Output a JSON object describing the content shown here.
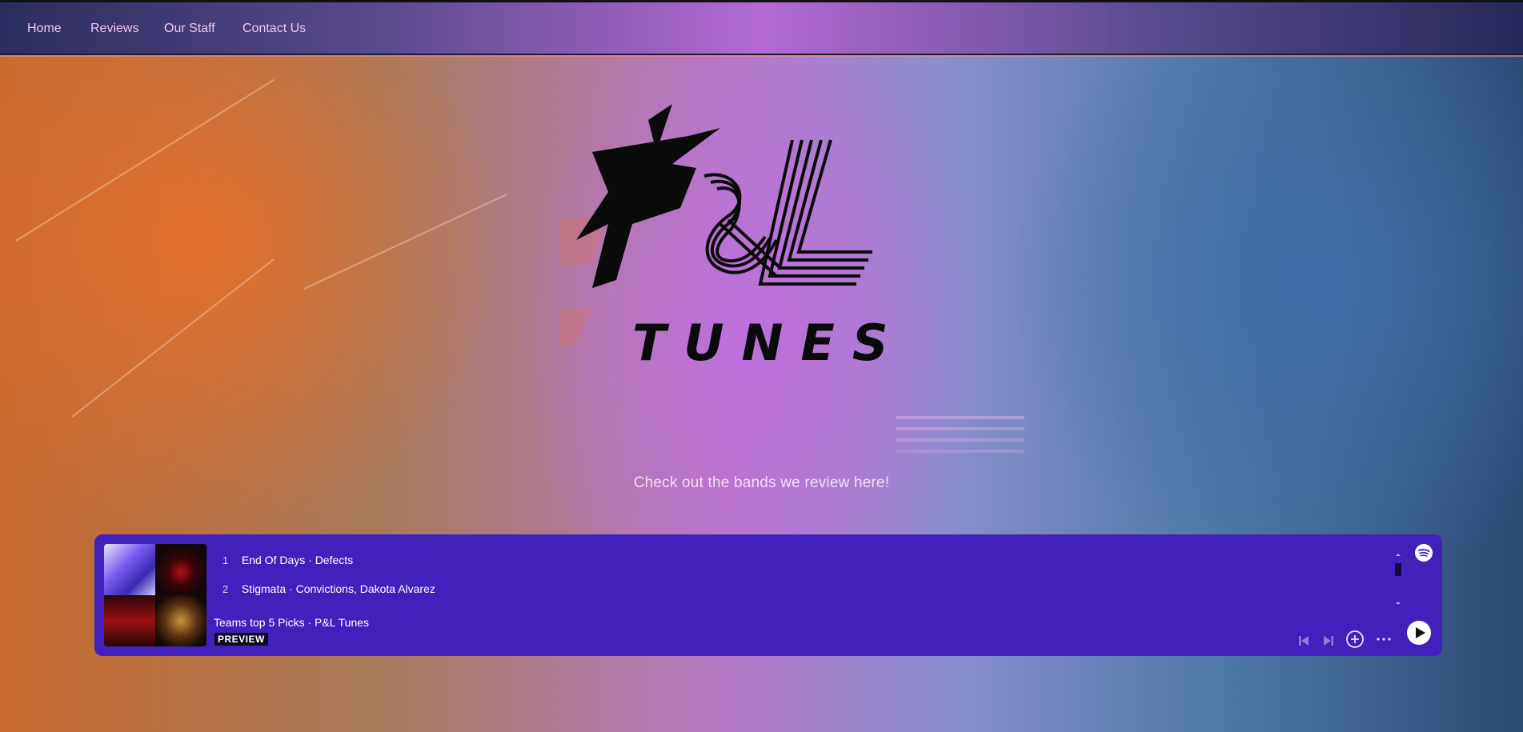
{
  "nav": {
    "items": [
      {
        "label": "Home"
      },
      {
        "label": "Reviews"
      },
      {
        "label": "Our Staff"
      },
      {
        "label": "Contact Us"
      }
    ]
  },
  "hero": {
    "logo_text": "P&L TUNES",
    "tagline": "Check out the bands we review here!"
  },
  "player": {
    "tracks": [
      {
        "number": "1",
        "title": "End Of Days · Defects"
      },
      {
        "number": "2",
        "title": "Stigmata · Convictions, Dakota Alvarez"
      }
    ],
    "playlist_title": "Teams top 5 Picks · P&L Tunes",
    "badge": "PREVIEW",
    "colors": {
      "background": "#4220bc",
      "badge_bg": "#0e0a22"
    },
    "icons": [
      "spotify-icon",
      "skip-back-icon",
      "skip-forward-icon",
      "add-icon",
      "more-icon",
      "play-icon"
    ]
  },
  "colors": {
    "nav_text": "#f1c6e6",
    "accent_purple": "#b46ad4"
  }
}
